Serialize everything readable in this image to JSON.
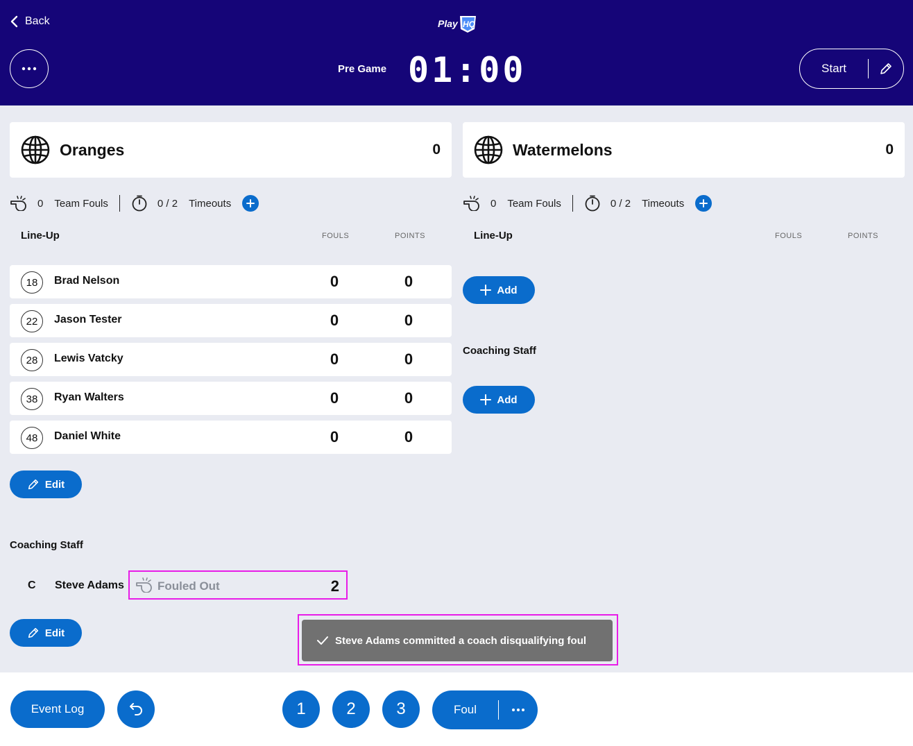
{
  "header": {
    "back_label": "Back",
    "period": "Pre Game",
    "clock": "01:00",
    "start_label": "Start"
  },
  "colors": {
    "header_bg": "#150578",
    "accent": "#0a6ccc",
    "highlight": "#e81ce8",
    "toast_bg": "#717171"
  },
  "home": {
    "name": "Oranges",
    "score": "0",
    "team_fouls": "0",
    "team_fouls_label": "Team Fouls",
    "timeouts": "0 / 2",
    "timeouts_label": "Timeouts",
    "lineup_title": "Line-Up",
    "fouls_col": "FOULS",
    "points_col": "POINTS",
    "players": [
      {
        "number": "18",
        "name": "Brad Nelson",
        "fouls": "0",
        "points": "0"
      },
      {
        "number": "22",
        "name": "Jason Tester",
        "fouls": "0",
        "points": "0"
      },
      {
        "number": "28",
        "name": "Lewis Vatcky",
        "fouls": "0",
        "points": "0"
      },
      {
        "number": "38",
        "name": "Ryan Walters",
        "fouls": "0",
        "points": "0"
      },
      {
        "number": "48",
        "name": "Daniel White",
        "fouls": "0",
        "points": "0"
      }
    ],
    "edit_label": "Edit",
    "coaching_title": "Coaching Staff",
    "coach": {
      "role": "C",
      "name": "Steve Adams",
      "status": "Fouled Out",
      "fouls": "2"
    },
    "coach_edit_label": "Edit"
  },
  "away": {
    "name": "Watermelons",
    "score": "0",
    "team_fouls": "0",
    "team_fouls_label": "Team Fouls",
    "timeouts": "0 / 2",
    "timeouts_label": "Timeouts",
    "lineup_title": "Line-Up",
    "fouls_col": "FOULS",
    "points_col": "POINTS",
    "add_player_label": "Add",
    "coaching_title": "Coaching Staff",
    "add_coach_label": "Add"
  },
  "toast": {
    "message": "Steve Adams committed a coach disqualifying foul"
  },
  "footer": {
    "event_log_label": "Event Log",
    "score_buttons": [
      "1",
      "2",
      "3"
    ],
    "foul_label": "Foul"
  }
}
